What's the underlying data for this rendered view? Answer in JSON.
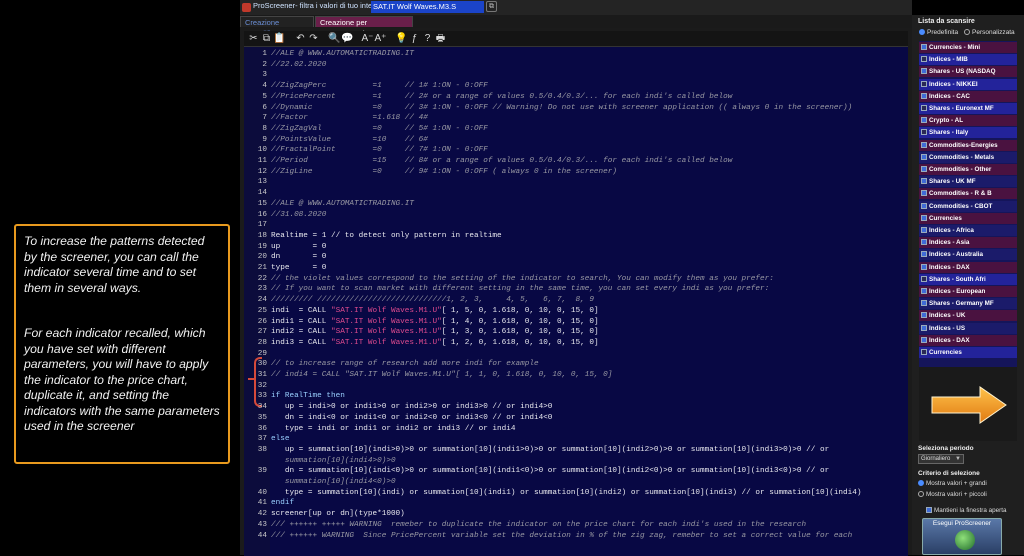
{
  "note": {
    "paragraph1": "To increase the patterns detected by the screener,  you can call  the indicator several time and to set them in several ways.",
    "paragraph2": "For each indicator recalled, which you have set with different parameters, you will have to apply the indicator to the price chart, duplicate it, and setting the indicators  with the same parameters used in the screener"
  },
  "window": {
    "title": "ProScreener- filtra i valori di tuo interesse - ",
    "screener_name": "SAT.IT Wolf Waves.M3.S"
  },
  "tabs": [
    "Creazione semplificata",
    "Creazione per Programmazione"
  ],
  "toolbar": {
    "icons": [
      "cut-icon",
      "copy-icon",
      "paste-icon",
      "undo-icon",
      "redo-icon",
      "search-icon",
      "comment-icon",
      "font-decrease-icon",
      "font-increase-icon",
      "bulb-icon",
      "function-icon",
      "help-icon",
      "print-icon"
    ],
    "glyphs": [
      "✂",
      "⧉",
      "📋",
      "↶",
      "↷",
      "🔍",
      "💬",
      "A⁻",
      "A⁺",
      "💡",
      "ƒ",
      "?",
      "🖶"
    ]
  },
  "code_lines": [
    {
      "n": "1",
      "t": "//ALE @ WWW.AUTOMATICTRADING.IT",
      "k": "cmt"
    },
    {
      "n": "2",
      "t": "//22.02.2020",
      "k": "cmt"
    },
    {
      "n": "3",
      "t": "",
      "k": "cmt"
    },
    {
      "n": "4",
      "t": "//ZigZagPerc          =1     // 1# 1:ON - 0:OFF",
      "k": "cmt"
    },
    {
      "n": "5",
      "t": "//PricePercent        =1     // 2# or a range of values 0.5/0.4/0.3/... for each indi's called below",
      "k": "cmt"
    },
    {
      "n": "6",
      "t": "//Dynamic             =0     // 3# 1:ON - 0:OFF // Warning! Do not use with screener application (( always 0 in the screener))",
      "k": "cmt"
    },
    {
      "n": "7",
      "t": "//Factor              =1.618 // 4#",
      "k": "cmt"
    },
    {
      "n": "8",
      "t": "//ZigZagVal           =0     // 5# 1:ON - 0:OFF",
      "k": "cmt"
    },
    {
      "n": "9",
      "t": "//PointsValue         =10    // 6#",
      "k": "cmt"
    },
    {
      "n": "10",
      "t": "//FractalPoint        =0     // 7# 1:ON - 0:OFF",
      "k": "cmt"
    },
    {
      "n": "11",
      "t": "//Period              =15    // 8# or a range of values 0.5/0.4/0.3/... for each indi's called below",
      "k": "cmt"
    },
    {
      "n": "12",
      "t": "//ZigLine             =0     // 9# 1:ON - 0:OFF ( always 0 in the screener)",
      "k": "cmt"
    },
    {
      "n": "13",
      "t": "",
      "k": "cmt"
    },
    {
      "n": "14",
      "t": "",
      "k": "cmt"
    },
    {
      "n": "15",
      "t": "//ALE @ WWW.AUTOMATICTRADING.IT",
      "k": "cmt"
    },
    {
      "n": "16",
      "t": "//31.08.2020",
      "k": "cmt"
    },
    {
      "n": "17",
      "t": "",
      "k": "cmt"
    },
    {
      "n": "18",
      "t": "Realtime = 1 // to detect only pattern in realtime",
      "k": "n"
    },
    {
      "n": "19",
      "t": "up       = 0",
      "k": "n"
    },
    {
      "n": "20",
      "t": "dn       = 0",
      "k": "n"
    },
    {
      "n": "21",
      "t": "type     = 0",
      "k": "n"
    },
    {
      "n": "22",
      "t": "// the violet values correspond to the setting of the indicator to search, You can modify them as you prefer:",
      "k": "cmt"
    },
    {
      "n": "23",
      "t": "// If you want to scan market with different setting in the same time, you can set every indi as you prefer:",
      "k": "cmt"
    },
    {
      "n": "24",
      "t": "///////// ////////////////////////////1, 2, 3,     4, 5,   6, 7,  8, 9",
      "k": "cmt"
    },
    {
      "n": "25",
      "t": "indi  = CALL \"SAT.IT Wolf Waves.M1.U\"[ 1, 5, 0, 1.618, 0, 10, 0, 15, 0]",
      "k": "call"
    },
    {
      "n": "26",
      "t": "indi1 = CALL \"SAT.IT Wolf Waves.M1.U\"[ 1, 4, 0, 1.618, 0, 10, 0, 15, 0]",
      "k": "call"
    },
    {
      "n": "27",
      "t": "indi2 = CALL \"SAT.IT Wolf Waves.M1.U\"[ 1, 3, 0, 1.618, 0, 10, 0, 15, 0]",
      "k": "call"
    },
    {
      "n": "28",
      "t": "indi3 = CALL \"SAT.IT Wolf Waves.M1.U\"[ 1, 2, 0, 1.618, 0, 10, 0, 15, 0]",
      "k": "call"
    },
    {
      "n": "29",
      "t": "",
      "k": "cmt"
    },
    {
      "n": "30",
      "t": "// to increase range of research add more indi for example",
      "k": "cmt"
    },
    {
      "n": "31",
      "t": "// indi4 = CALL \"SAT.IT Wolf Waves.M1.U\"[ 1, 1, 0, 1.618, 0, 10, 0, 15, 0]",
      "k": "cmt"
    },
    {
      "n": "32",
      "t": "",
      "k": "cmt"
    },
    {
      "n": "33",
      "t": "if RealTime then",
      "k": "kw"
    },
    {
      "n": "34",
      "t": "   up = indi>0 or indi1>0 or indi2>0 or indi3>0 // or indi4>0",
      "k": "n"
    },
    {
      "n": "35",
      "t": "   dn = indi<0 or indi1<0 or indi2<0 or indi3<0 // or indi4<0",
      "k": "n"
    },
    {
      "n": "36",
      "t": "   type = indi or indi1 or indi2 or indi3 // or indi4",
      "k": "n"
    },
    {
      "n": "37",
      "t": "else",
      "k": "kw"
    },
    {
      "n": "38",
      "t": "   up = summation[10](indi>0)>0 or summation[10](indi1>0)>0 or summation[10](indi2>0)>0 or summation[10](indi3>0)>0 // or",
      "k": "n"
    },
    {
      "n": "",
      "t": "   summation[10](indi4>0)>0",
      "k": "cmt"
    },
    {
      "n": "39",
      "t": "   dn = summation[10](indi<0)>0 or summation[10](indi1<0)>0 or summation[10](indi2<0)>0 or summation[10](indi3<0)>0 // or",
      "k": "n"
    },
    {
      "n": "",
      "t": "   summation[10](indi4<0)>0",
      "k": "cmt"
    },
    {
      "n": "40",
      "t": "   type = summation[10](indi) or summation[10](indi1) or summation[10](indi2) or summation[10](indi3) // or summation[10](indi4)",
      "k": "n"
    },
    {
      "n": "41",
      "t": "endif",
      "k": "kw"
    },
    {
      "n": "42",
      "t": "screener[up or dn](type*1000)",
      "k": "n"
    },
    {
      "n": "43",
      "t": "/// ++++++ +++++ WARNING  remeber to duplicate the indicator on the price chart for each indi's used in the research",
      "k": "cmt"
    },
    {
      "n": "44",
      "t": "/// ++++++ WARNING  Since PricePercent variable set the deviation in % of the zig zag, remeber to set a correct value for each",
      "k": "cmt"
    }
  ],
  "panel": {
    "title": "Lista da scansire",
    "radio_predefined": "Predefinita",
    "radio_custom": "Personalizzata",
    "items": [
      {
        "label": "Currencies - Mini",
        "checked": true
      },
      {
        "label": "Indices - MIB",
        "checked": false
      },
      {
        "label": "Shares - US (NASDAQ",
        "checked": true
      },
      {
        "label": "Indices - NIKKEI",
        "checked": false
      },
      {
        "label": "Indices - CAC",
        "checked": true
      },
      {
        "label": "Shares - Euronext MF",
        "checked": false
      },
      {
        "label": "Crypto - AL",
        "checked": true
      },
      {
        "label": "Shares - Italy",
        "checked": false
      },
      {
        "label": "Commodities-Energies",
        "checked": true
      },
      {
        "label": "Commodities - Metals",
        "checked": true
      },
      {
        "label": "Commodities - Other",
        "checked": true
      },
      {
        "label": "Shares - UK MF",
        "checked": true
      },
      {
        "label": "Commodities - R & B",
        "checked": true
      },
      {
        "label": "Commodities - CBOT",
        "checked": true
      },
      {
        "label": "Currencies",
        "checked": true
      },
      {
        "label": "Indices - Africa",
        "checked": true
      },
      {
        "label": "Indices - Asia",
        "checked": true
      },
      {
        "label": "Indices - Australia",
        "checked": true
      },
      {
        "label": "Indices - DAX",
        "checked": true
      },
      {
        "label": "Shares - South Afri",
        "checked": false
      },
      {
        "label": "Indices - European",
        "checked": true
      },
      {
        "label": "Shares - Germany MF",
        "checked": true
      },
      {
        "label": "Indices - UK",
        "checked": true
      },
      {
        "label": "Indices - US",
        "checked": true
      },
      {
        "label": "Indices - DAX",
        "checked": true
      },
      {
        "label": "Currencies",
        "checked": false
      }
    ],
    "period_label": "Seleziona periodo",
    "period_value": "Giornaliero",
    "criteria_label": "Criterio di selezione",
    "criteria_opt1": "Mostra valori + grandi",
    "criteria_opt2": "Mostra valori + piccoli",
    "keep_open": "Mantieni la finestra aperta",
    "run_button": "Esegui ProScreener",
    "accent": "#f39a1e"
  }
}
